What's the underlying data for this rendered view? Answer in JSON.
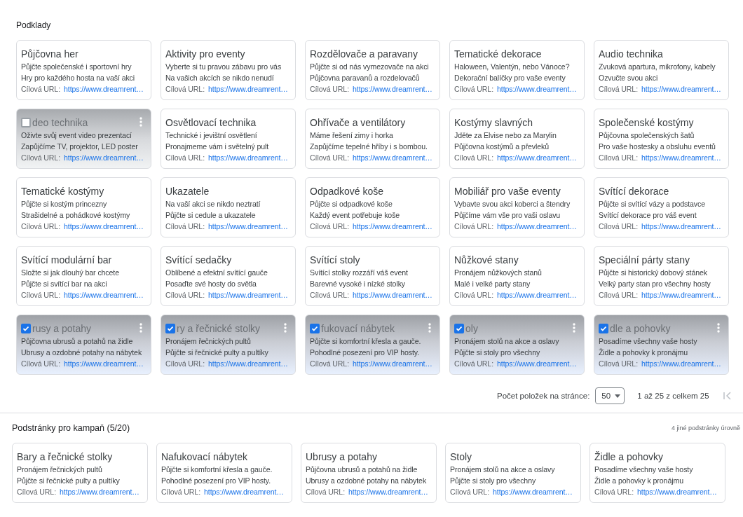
{
  "section_title": "Podklady",
  "assets": [
    {
      "title": "Půjčovna her",
      "lines": [
        "Půjčte společenské i sportovní hry",
        "Hry pro každého hosta na vaší akci"
      ],
      "url_label": "Cílová URL:",
      "url": "https://www.dreamrent…",
      "hovered": false,
      "selected": false
    },
    {
      "title": "Aktivity pro eventy",
      "lines": [
        "Vyberte si tu pravou zábavu pro vás",
        "Na vašich akcích se nikdo nenudí"
      ],
      "url_label": "Cílová URL:",
      "url": "https://www.dreamrent…",
      "hovered": false,
      "selected": false
    },
    {
      "title": "Rozdělovače a paravany",
      "lines": [
        "Půjčte si od nás vymezovače na akci",
        "Půjčovna paravanů a rozdelovačů"
      ],
      "url_label": "Cílová URL:",
      "url": "https://www.dreamrent…",
      "hovered": false,
      "selected": false
    },
    {
      "title": "Tematické dekorace",
      "lines": [
        "Haloween, Valentýn, nebo Vánoce?",
        "Dekorační balíčky pro vaše eventy"
      ],
      "url_label": "Cílová URL:",
      "url": "https://www.dreamrent…",
      "hovered": false,
      "selected": false
    },
    {
      "title": "Audio technika",
      "lines": [
        "Zvuková apartura, mikrofony, kabely",
        "Ozvučte svou akci"
      ],
      "url_label": "Cílová URL:",
      "url": "https://www.dreamrent…",
      "hovered": false,
      "selected": false
    },
    {
      "title": "deo technika",
      "lines": [
        "Oživte svůj event video prezentací",
        "Zapůjčíme TV, projektor, LED poster"
      ],
      "url_label": "Cílová URL:",
      "url": "https://www.dreamrent…",
      "hovered": true,
      "selected": false
    },
    {
      "title": "Osvětlovací technika",
      "lines": [
        "Technické i jevištní osvětlení",
        "Pronajmeme vám i světelný pult"
      ],
      "url_label": "Cílová URL:",
      "url": "https://www.dreamrent…",
      "hovered": false,
      "selected": false
    },
    {
      "title": "Ohřívače a ventilátory",
      "lines": [
        "Máme řešení zimy i horka",
        "Zapůjčíme tepelné hříby i s bombou."
      ],
      "url_label": "Cílová URL:",
      "url": "https://www.dreamrent…",
      "hovered": false,
      "selected": false
    },
    {
      "title": "Kostýmy slavných",
      "lines": [
        "Jděte za Elvise nebo za Marylin",
        "Půjčovna kostýmů a převleků"
      ],
      "url_label": "Cílová URL:",
      "url": "https://www.dreamrent…",
      "hovered": false,
      "selected": false
    },
    {
      "title": "Společenské kostýmy",
      "lines": [
        "Půjčovna společenských šatů",
        "Pro vaše hostesky a obsluhu eventů"
      ],
      "url_label": "Cílová URL:",
      "url": "https://www.dreamrent…",
      "hovered": false,
      "selected": false
    },
    {
      "title": "Tematické kostýmy",
      "lines": [
        "Půjčte si kostým princezny",
        "Strašidelné a pohádkové kostýmy"
      ],
      "url_label": "Cílová URL:",
      "url": "https://www.dreamrent…",
      "hovered": false,
      "selected": false
    },
    {
      "title": "Ukazatele",
      "lines": [
        "Na vaší akci se nikdo neztratí",
        "Půjčte si cedule a ukazatele"
      ],
      "url_label": "Cílová URL:",
      "url": "https://www.dreamrent…",
      "hovered": false,
      "selected": false
    },
    {
      "title": "Odpadkové koše",
      "lines": [
        "Půjčte si odpadkové koše",
        "Každý event potřebuje koše"
      ],
      "url_label": "Cílová URL:",
      "url": "https://www.dreamrent…",
      "hovered": false,
      "selected": false
    },
    {
      "title": "Mobiliář pro vaše eventy",
      "lines": [
        "Vybavte svou akci koberci a štendry",
        "Půjčíme vám vše pro vaši oslavu"
      ],
      "url_label": "Cílová URL:",
      "url": "https://www.dreamrent…",
      "hovered": false,
      "selected": false
    },
    {
      "title": "Svítící dekorace",
      "lines": [
        "Půjčte si svítící vázy a podstavce",
        "Svítící dekorace pro váš event"
      ],
      "url_label": "Cílová URL:",
      "url": "https://www.dreamrent…",
      "hovered": false,
      "selected": false
    },
    {
      "title": "Svítící modulární bar",
      "lines": [
        "Složte si jak dlouhý bar chcete",
        "Půjčte si svítící bar na akci"
      ],
      "url_label": "Cílová URL:",
      "url": "https://www.dreamrent…",
      "hovered": false,
      "selected": false
    },
    {
      "title": "Svítící sedačky",
      "lines": [
        "Oblíbené a efektní svítící gauče",
        "Posaďte své hosty do světla"
      ],
      "url_label": "Cílová URL:",
      "url": "https://www.dreamrent…",
      "hovered": false,
      "selected": false
    },
    {
      "title": "Svítící stoly",
      "lines": [
        "Svítící stolky rozzáří váš event",
        "Barevné vysoké i nízké stolky"
      ],
      "url_label": "Cílová URL:",
      "url": "https://www.dreamrent…",
      "hovered": false,
      "selected": false
    },
    {
      "title": "Nůžkové stany",
      "lines": [
        "Pronájem nůžkových stanů",
        "Malé i velké party stany"
      ],
      "url_label": "Cílová URL:",
      "url": "https://www.dreamrent…",
      "hovered": false,
      "selected": false
    },
    {
      "title": "Speciální párty stany",
      "lines": [
        "Půjčte si historický dobový stánek",
        "Velký party stan pro všechny hosty"
      ],
      "url_label": "Cílová URL:",
      "url": "https://www.dreamrent…",
      "hovered": false,
      "selected": false
    },
    {
      "title": "rusy a potahy",
      "lines": [
        "Půjčovna ubrusů a potahů na židle",
        "Ubrusy a ozdobné potahy na nábytek"
      ],
      "url_label": "Cílová URL:",
      "url": "https://www.dreamrent…",
      "hovered": false,
      "selected": true
    },
    {
      "title": "ry a řečnické stolky",
      "lines": [
        "Pronájem řečnických pultů",
        "Půjčte si řečnické pulty a pultíky"
      ],
      "url_label": "Cílová URL:",
      "url": "https://www.dreamrent…",
      "hovered": false,
      "selected": true
    },
    {
      "title": "fukovací nábytek",
      "lines": [
        "Půjčte si komfortní křesla a gauče.",
        "Pohodlné posezení pro VIP hosty."
      ],
      "url_label": "Cílová URL:",
      "url": "https://www.dreamrent…",
      "hovered": false,
      "selected": true
    },
    {
      "title": "oly",
      "lines": [
        "Pronájem stolů na akce a oslavy",
        "Půjčte si stoly pro všechny"
      ],
      "url_label": "Cílová URL:",
      "url": "https://www.dreamrent…",
      "hovered": false,
      "selected": true
    },
    {
      "title": "dle a pohovky",
      "lines": [
        "Posadíme všechny vaše hosty",
        "Židle a pohovky k pronájmu"
      ],
      "url_label": "Cílová URL:",
      "url": "https://www.dreamrent…",
      "hovered": false,
      "selected": true
    }
  ],
  "pagination": {
    "per_page_label": "Počet položek na stránce:",
    "per_page_value": "50",
    "range": "1 až 25 z celkem 25"
  },
  "subpages": {
    "title": "Podstránky pro kampaň (5/20)",
    "note": "4 jiné podstránky úrovně",
    "items": [
      {
        "title": "Bary a řečnické stolky",
        "lines": [
          "Pronájem řečnických pultů",
          "Půjčte si řečnické pulty a pultíky"
        ],
        "url_label": "Cílová URL:",
        "url": "https://www.dreamrent…"
      },
      {
        "title": "Nafukovací nábytek",
        "lines": [
          "Půjčte si komfortní křesla a gauče.",
          "Pohodlné posezení pro VIP hosty."
        ],
        "url_label": "Cílová URL:",
        "url": "https://www.dreamrent…"
      },
      {
        "title": "Ubrusy a potahy",
        "lines": [
          "Půjčovna ubrusů a potahů na židle",
          "Ubrusy a ozdobné potahy na nábytek"
        ],
        "url_label": "Cílová URL:",
        "url": "https://www.dreamrent…"
      },
      {
        "title": "Stoly",
        "lines": [
          "Pronájem stolů na akce a oslavy",
          "Půjčte si stoly pro všechny"
        ],
        "url_label": "Cílová URL:",
        "url": "https://www.dreamrent…"
      },
      {
        "title": "Židle a pohovky",
        "lines": [
          "Posadíme všechny vaše hosty",
          "Židle a pohovky k pronájmu"
        ],
        "url_label": "Cílová URL:",
        "url": "https://www.dreamrent…"
      }
    ]
  }
}
